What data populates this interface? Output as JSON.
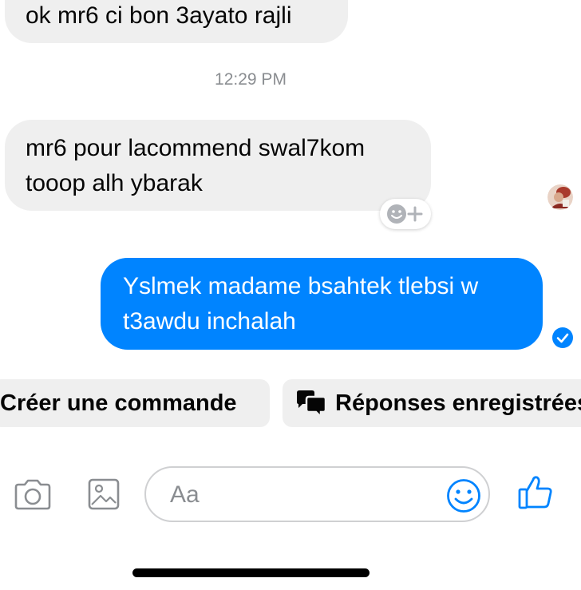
{
  "conversation": {
    "messages": [
      {
        "sender": "contact",
        "text": "ok mr6 ci bon 3ayato rajli"
      },
      {
        "sender": "contact",
        "text": "mr6 pour lacommend swal7kom\ntooop alh ybarak"
      },
      {
        "sender": "me",
        "text": "Yslmek madame bsahtek tlebsi w\nt3awdu inchalah"
      }
    ],
    "timestamp": "12:29 PM"
  },
  "quick_replies": {
    "create_order": "Créer une commande",
    "saved_replies": "Réponses enregistrées"
  },
  "composer": {
    "placeholder": "Aa",
    "value": ""
  },
  "icons": {
    "camera": "camera-icon",
    "gallery": "image-icon",
    "emoji": "emoji-icon",
    "like": "thumbs-up-icon",
    "reaction": "add-reaction-icon",
    "saved_replies": "chat-bubbles-icon",
    "read": "checkmark-icon"
  },
  "colors": {
    "accent": "#0084ff",
    "incoming_bubble": "#efefef",
    "timestamp": "#8a8d91"
  }
}
